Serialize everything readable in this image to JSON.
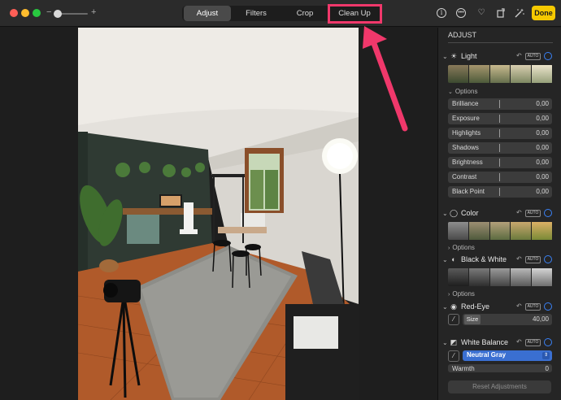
{
  "toolbar": {
    "zoom_minus": "−",
    "zoom_plus": "+",
    "tabs": [
      "Adjust",
      "Filters",
      "Crop",
      "Clean Up"
    ],
    "active_tab": "Adjust",
    "highlighted_tab": "Clean Up",
    "done_label": "Done",
    "icons": [
      "info-icon",
      "more-icon",
      "heart-icon",
      "rotate-icon",
      "magic-wand-icon"
    ],
    "done_color": "#f5c900",
    "highlight_color": "#f0386b"
  },
  "sidebar": {
    "title": "ADJUST",
    "light": {
      "label": "Light",
      "auto": "AUTO",
      "options": "Options",
      "sliders": [
        {
          "label": "Brilliance",
          "value": "0,00"
        },
        {
          "label": "Exposure",
          "value": "0,00"
        },
        {
          "label": "Highlights",
          "value": "0,00"
        },
        {
          "label": "Shadows",
          "value": "0,00"
        },
        {
          "label": "Brightness",
          "value": "0,00"
        },
        {
          "label": "Contrast",
          "value": "0,00"
        },
        {
          "label": "Black Point",
          "value": "0,00"
        }
      ]
    },
    "color": {
      "label": "Color",
      "auto": "AUTO",
      "options": "Options"
    },
    "bw": {
      "label": "Black & White",
      "auto": "AUTO",
      "options": "Options"
    },
    "redeye": {
      "label": "Red-Eye",
      "auto": "AUTO",
      "size_label": "Size",
      "size_value": "40,00"
    },
    "wb": {
      "label": "White Balance",
      "auto": "AUTO",
      "mode": "Neutral Gray",
      "warmth_label": "Warmth",
      "warmth_value": "0"
    },
    "reset_label": "Reset Adjustments"
  }
}
